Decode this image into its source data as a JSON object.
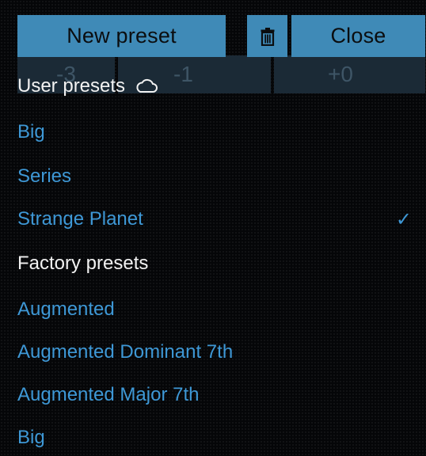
{
  "background_cells": [
    "-3",
    "-1",
    "+0"
  ],
  "toolbar": {
    "new_preset_label": "New preset",
    "close_label": "Close",
    "delete_icon": "trash-icon"
  },
  "user_presets": {
    "header": "User presets",
    "icon": "cloud-icon",
    "items": [
      {
        "label": "Big",
        "selected": false
      },
      {
        "label": "Series",
        "selected": false
      },
      {
        "label": "Strange Planet",
        "selected": true,
        "check": "✓"
      }
    ]
  },
  "factory_presets": {
    "header": "Factory presets",
    "items": [
      {
        "label": "Augmented"
      },
      {
        "label": "Augmented Dominant 7th"
      },
      {
        "label": "Augmented Major 7th"
      },
      {
        "label": "Big"
      }
    ]
  },
  "colors": {
    "button_bg": "#3f8ab7",
    "item_text": "#3e98d6",
    "header_text": "#f2f2f2",
    "background": "#050608"
  }
}
